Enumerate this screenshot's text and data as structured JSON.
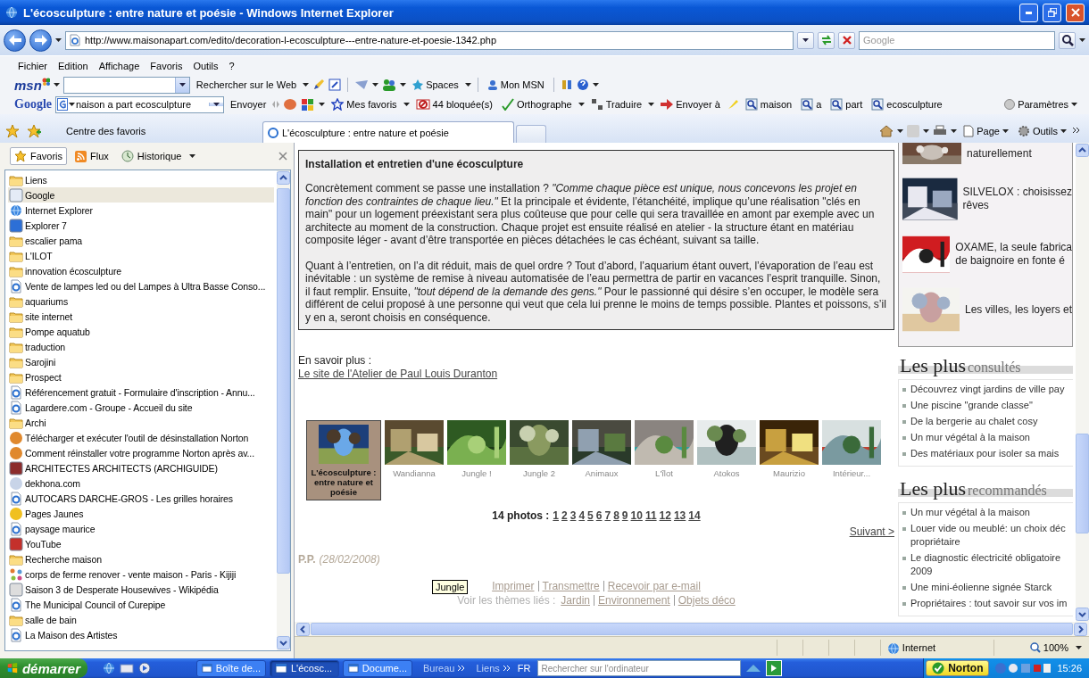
{
  "window": {
    "title": "L'écosculpture : entre nature et poésie - Windows Internet Explorer"
  },
  "address_bar": {
    "url": "http://www.maisonapart.com/edito/decoration-l-ecosculpture---entre-nature-et-poesie-1342.php",
    "search_placeholder": "Google"
  },
  "menu": [
    "Fichier",
    "Edition",
    "Affichage",
    "Favoris",
    "Outils",
    "?"
  ],
  "msn_toolbar": {
    "logo": "msn",
    "search_label": "Rechercher sur le Web",
    "items": [
      "Spaces",
      "Mon MSN"
    ]
  },
  "google_toolbar": {
    "logo": "Google",
    "query": "naison a part ecosculpture",
    "send": "Envoyer",
    "items": [
      {
        "label": "Mes favoris",
        "kind": "star"
      },
      {
        "label": "44 bloquée(s)",
        "kind": "block"
      },
      {
        "label": "Orthographe",
        "kind": "spell"
      },
      {
        "label": "Traduire",
        "kind": "translate"
      },
      {
        "label": "Envoyer à",
        "kind": "send"
      },
      {
        "label": "maison",
        "kind": "find"
      },
      {
        "label": "a",
        "kind": "find"
      },
      {
        "label": "part",
        "kind": "find"
      },
      {
        "label": "ecosculpture",
        "kind": "find"
      }
    ],
    "settings": "Paramètres"
  },
  "favorites_center": "Centre des favoris",
  "tabs": [
    {
      "label": "L'écosculpture : entre nature et poésie",
      "selected": true
    }
  ],
  "command_bar": [
    "Page",
    "Outils"
  ],
  "sidebar": {
    "tabs": [
      {
        "label": "Favoris",
        "selected": true
      },
      {
        "label": "Flux",
        "selected": false
      },
      {
        "label": "Historique",
        "selected": false
      }
    ],
    "items": [
      {
        "label": "Liens",
        "kind": "folder",
        "selected": false
      },
      {
        "label": "Google",
        "kind": "tile",
        "color": "#e4ebf6",
        "selected": true
      },
      {
        "label": "Internet Explorer",
        "kind": "browser",
        "selected": false
      },
      {
        "label": "Explorer 7",
        "kind": "tile",
        "color": "#2c6fd6",
        "selected": false
      },
      {
        "label": "escalier pama",
        "kind": "folder",
        "selected": false
      },
      {
        "label": "L'ILOT",
        "kind": "folder",
        "selected": false
      },
      {
        "label": "innovation écosculpture",
        "kind": "folder",
        "selected": false
      },
      {
        "label": "Vente de lampes led ou del Lampes à Ultra Basse Conso...",
        "kind": "page",
        "selected": false
      },
      {
        "label": "aquariums",
        "kind": "folder",
        "selected": false
      },
      {
        "label": "site internet",
        "kind": "folder",
        "selected": false
      },
      {
        "label": "Pompe aquatub",
        "kind": "folder",
        "selected": false
      },
      {
        "label": "traduction",
        "kind": "folder",
        "selected": false
      },
      {
        "label": "Sarojini",
        "kind": "folder",
        "selected": false
      },
      {
        "label": "Prospect",
        "kind": "folder",
        "selected": false
      },
      {
        "label": "Référencement gratuit - Formulaire d'inscription - Annu...",
        "kind": "page",
        "selected": false
      },
      {
        "label": "Lagardere.com - Groupe - Accueil du site",
        "kind": "page",
        "selected": false
      },
      {
        "label": "Archi",
        "kind": "folder",
        "selected": false
      },
      {
        "label": "Télécharger et exécuter l'outil de désinstallation Norton",
        "kind": "round",
        "color": "#e0892e",
        "selected": false
      },
      {
        "label": "Comment réinstaller votre programme Norton après av...",
        "kind": "round",
        "color": "#e0892e",
        "selected": false
      },
      {
        "label": "ARCHITECTES ARCHITECTS (ARCHIGUIDE)",
        "kind": "tile",
        "color": "#8b2c2c",
        "selected": false
      },
      {
        "label": "dekhona.com",
        "kind": "round",
        "color": "#c8d4e8",
        "selected": false
      },
      {
        "label": "AUTOCARS DARCHE-GROS - Les grilles horaires",
        "kind": "page",
        "selected": false
      },
      {
        "label": "Pages Jaunes",
        "kind": "round",
        "color": "#f0c020",
        "selected": false
      },
      {
        "label": "paysage maurice",
        "kind": "page",
        "selected": false
      },
      {
        "label": "YouTube",
        "kind": "tile",
        "color": "#c4302b",
        "selected": false
      },
      {
        "label": "Recherche maison",
        "kind": "folder",
        "selected": false
      },
      {
        "label": "corps de ferme renover - vente maison - Paris - Kijiji",
        "kind": "dots",
        "selected": false
      },
      {
        "label": "Saison 3 de Desperate Housewives - Wikipédia",
        "kind": "tile",
        "color": "#dddddd",
        "selected": false
      },
      {
        "label": "The Municipal Council of Curepipe",
        "kind": "page",
        "selected": false
      },
      {
        "label": "salle de bain",
        "kind": "folder",
        "selected": false
      },
      {
        "label": "La Maison des Artistes",
        "kind": "page",
        "selected": false
      }
    ]
  },
  "article": {
    "heading": "Installation et entretien d'une écosculpture",
    "paragraphs": [
      "Concrètement comment se passe une installation ? *\"Comme chaque pièce est unique, nous concevons les projet en fonction des contraintes de chaque lieu.\"* Et la principale et évidente, l’étanchéité, implique qu’une réalisation \"clés en main\" pour un logement préexistant sera plus coûteuse que pour celle qui sera travaillée en amont par exemple avec un architecte au moment de la construction. Chaque projet est ensuite réalisé en atelier - la structure étant en matériau composite léger - avant d’être transportée en pièces détachées le cas échéant, suivant sa taille.",
      "Quant à l’entretien, on l’a dit réduit, mais de quel ordre ? Tout d’abord, l’aquarium étant ouvert, l’évaporation de l’eau est inévitable : un système de remise à niveau automatisée de l’eau permettra de partir en vacances l’esprit tranquille. Sinon, il faut remplir. Ensuite, *\"tout dépend de la demande des gens.\"* Pour le passionné qui désire s’en occuper, le modèle sera différent de celui proposé à une personne qui veut que cela lui prenne le moins de temps possible. Plantes et poissons, s’il y en a, seront choisis en conséquence."
    ],
    "more_label": "En savoir plus :",
    "more_link": "Le site de l'Atelier de Paul Louis Duranton"
  },
  "gallery": {
    "photos": [
      {
        "caption": "L'écosculpture : entre nature et poésie",
        "selected": true
      },
      {
        "caption": "Wandianna",
        "selected": false
      },
      {
        "caption": "Jungle !",
        "selected": false
      },
      {
        "caption": "Jungle 2",
        "selected": false
      },
      {
        "caption": "Animaux",
        "selected": false
      },
      {
        "caption": "L'îlot",
        "selected": false
      },
      {
        "caption": "Atokos",
        "selected": false
      },
      {
        "caption": "Maurizio",
        "selected": false
      },
      {
        "caption": "Intérieur...",
        "selected": false
      }
    ],
    "count_label": "14 photos :",
    "pages": [
      "1",
      "2",
      "3",
      "4",
      "5",
      "6",
      "7",
      "8",
      "9",
      "10",
      "11",
      "12",
      "13",
      "14"
    ],
    "next": "Suivant >"
  },
  "byline": {
    "author": "P.P.",
    "date": "(28/02/2008)"
  },
  "footer_links": {
    "actions": [
      "Imprimer",
      "Transmettre",
      "Recevoir par e-mail"
    ],
    "themes_label": "Voir les thèmes liés :",
    "themes": [
      "Jardin",
      "Environnement",
      "Objets déco"
    ]
  },
  "tooltip": "Jungle",
  "right_column": {
    "ads": [
      {
        "lines": [
          "naturellement"
        ]
      },
      {
        "lines": [
          "SILVELOX : choisissez",
          "rêves"
        ]
      },
      {
        "lines": [
          "OXAME, la seule fabrica",
          "de baignoire en fonte é"
        ]
      },
      {
        "lines": [
          "Les villes, les loyers et"
        ]
      }
    ],
    "sections": [
      {
        "title": "Les plus",
        "subtitle": "consultés",
        "items": [
          {
            "lines": [
              "Découvrez vingt jardins de ville pay"
            ]
          },
          {
            "lines": [
              "Une piscine \"grande classe\""
            ]
          },
          {
            "lines": [
              "De la bergerie au chalet cosy"
            ]
          },
          {
            "lines": [
              "Un mur végétal à la maison"
            ]
          },
          {
            "lines": [
              "Des matériaux pour isoler sa mais"
            ]
          }
        ]
      },
      {
        "title": "Les plus",
        "subtitle": "recommandés",
        "items": [
          {
            "lines": [
              "Un mur végétal à la maison"
            ]
          },
          {
            "lines": [
              "Louer vide ou meublé: un choix déc",
              "propriétaire"
            ]
          },
          {
            "lines": [
              "Le diagnostic électricité obligatoire",
              "2009"
            ]
          },
          {
            "lines": [
              "Une mini-éolienne signée Starck"
            ]
          },
          {
            "lines": [
              "Propriétaires : tout savoir sur vos im"
            ]
          }
        ]
      }
    ]
  },
  "status_bar": {
    "zone": "Internet",
    "zoom": "100%"
  },
  "taskbar": {
    "start": "démarrer",
    "tasks": [
      {
        "label": "Boîte de...",
        "selected": false
      },
      {
        "label": "L'écosc...",
        "selected": true
      },
      {
        "label": "Docume...",
        "selected": false
      }
    ],
    "toolbars": [
      "Bureau",
      "Liens"
    ],
    "language": "FR",
    "search_placeholder": "Rechercher sur l'ordinateur",
    "norton": "Norton",
    "clock": "15:26"
  }
}
